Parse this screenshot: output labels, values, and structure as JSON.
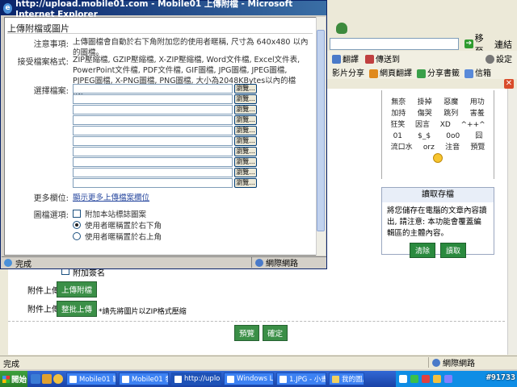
{
  "background_browser": {
    "go_label": "移至",
    "links_label": "連結",
    "toolbar1": [
      "翻譯",
      "傳送到",
      "設定"
    ],
    "toolbar2": [
      "影片分享",
      "網頁翻譯",
      "分享書籤",
      "信箱"
    ],
    "smilies": [
      [
        "無奈",
        "掛掉",
        "惡魔",
        "用功"
      ],
      [
        "加持",
        "傷哭",
        "跳列",
        "害羞"
      ],
      [
        "狂笑",
        "因言",
        "XD",
        "^++^"
      ],
      [
        "01",
        "$_$",
        "0o0",
        "囧"
      ],
      [
        "流口水",
        "orz",
        "注音",
        "預覽"
      ]
    ],
    "save_box": {
      "title": "讀取存檔",
      "text": "將您儲存在電腦的文章內容讀出, 請注意: 本功能會覆蓋編輯區的主體內容。",
      "clear_label": "清除",
      "load_label": "讀取"
    },
    "form": {
      "signature_label": "附加簽名",
      "attach_label": "附件上傳:",
      "upload_attach_btn": "上傳附檔",
      "image_label": "附件上傳:",
      "batch_upload_btn": "整批上傳",
      "batch_note": "*請先將圖片以ZIP格式壓縮",
      "preview_btn": "預覽",
      "confirm_btn": "確定"
    },
    "status_text": "完成",
    "zone_text": "網際網路"
  },
  "popup": {
    "title": "http://upload.mobile01.com - Mobile01 上傳附檔 - Microsoft Internet Explorer",
    "header": "上傳附檔或圖片",
    "notice_label": "注意事項:",
    "notice_text": "上傳圖檔會自動於右下角附加您的使用者暱稱, 尺寸為 640x480 以內的圖檔。",
    "formats_label": "接受檔案格式:",
    "formats_text": "ZIP壓縮檔, GZIP壓縮檔, X-ZIP壓縮檔, Word文件檔, Excel文件表, PowerPoint文件檔, PDF文件檔, GIF圖檔, JPG圖檔, JPEG圖檔, PJPEG圖檔, X-PNG圖檔, PNG圖檔, 大小為2048KBytes以內的檔案。",
    "select_label": "選擇檔案:",
    "browse_label": "瀏覽...",
    "more_label": "更多欄位:",
    "more_link": "顯示更多上傳檔案欄位",
    "image_opts_label": "圖檔選項:",
    "opt_watermark": "附加本站標誌圖案",
    "opt_bottom_right": "使用者暱稱置於右下角",
    "opt_top_right": "使用者暱稱置於右上角",
    "status_text": "完成",
    "zone_text": "網際網路"
  },
  "taskbar": {
    "start_label": "開始",
    "tasks": [
      "Mobile01 影...",
      "Mobile01 發...",
      "http://upload...",
      "Windows Liv...",
      "1.JPG - 小畫...",
      "我的圖片"
    ]
  },
  "watermark": "#91733"
}
